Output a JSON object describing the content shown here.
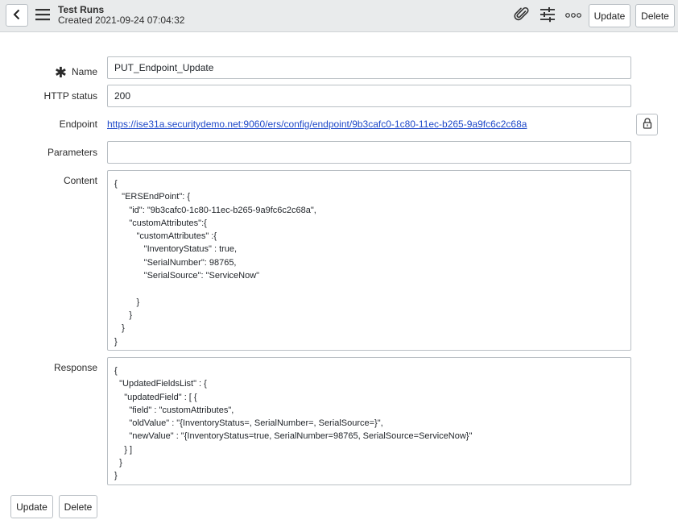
{
  "header": {
    "title": "Test Runs",
    "subtitle": "Created 2021-09-24 07:04:32",
    "update_label": "Update",
    "delete_label": "Delete"
  },
  "form": {
    "name": {
      "label": "Name",
      "value": "PUT_Endpoint_Update"
    },
    "http_status": {
      "label": "HTTP status",
      "value": "200"
    },
    "endpoint": {
      "label": "Endpoint",
      "value": "https://ise31a.securitydemo.net:9060/ers/config/endpoint/9b3cafc0-1c80-11ec-b265-9a9fc6c2c68a"
    },
    "parameters": {
      "label": "Parameters",
      "value": ""
    },
    "content": {
      "label": "Content",
      "value": "{\n   \"ERSEndPoint\": {\n      \"id\": \"9b3cafc0-1c80-11ec-b265-9a9fc6c2c68a\",\n      \"customAttributes\":{\n         \"customAttributes\" :{\n            \"InventoryStatus\" : true,\n            \"SerialNumber\": 98765,\n            \"SerialSource\": \"ServiceNow\"\n\n         }\n      }\n   }\n}"
    },
    "response": {
      "label": "Response",
      "value": "{\n  \"UpdatedFieldsList\" : {\n    \"updatedField\" : [ {\n      \"field\" : \"customAttributes\",\n      \"oldValue\" : \"{InventoryStatus=, SerialNumber=, SerialSource=}\",\n      \"newValue\" : \"{InventoryStatus=true, SerialNumber=98765, SerialSource=ServiceNow}\"\n    } ]\n  }\n}"
    }
  },
  "footer": {
    "update_label": "Update",
    "delete_label": "Delete"
  },
  "icons": {
    "back": "chevron-left-icon",
    "menu": "hamburger-icon",
    "attach": "paperclip-icon",
    "settings": "sliders-icon",
    "more": "more-options-icon",
    "lock": "lock-icon"
  }
}
